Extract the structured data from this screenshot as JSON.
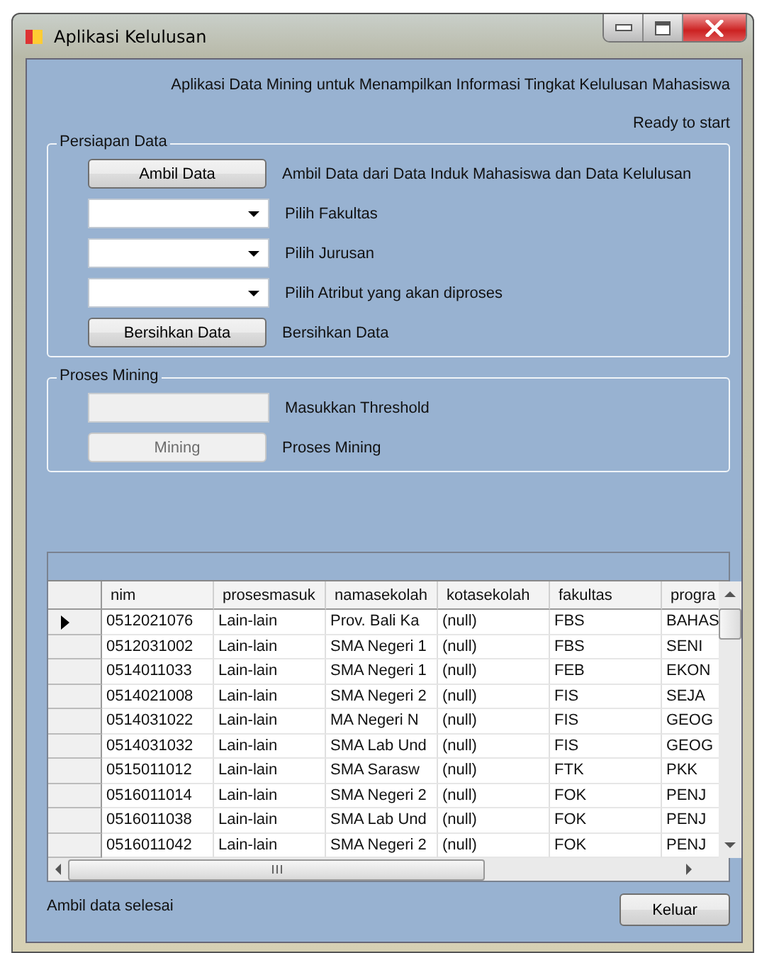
{
  "window": {
    "title": "Aplikasi Kelulusan"
  },
  "heading": "Aplikasi Data Mining untuk Menampilkan Informasi Tingkat Kelulusan Mahasiswa",
  "status_top": "Ready to start",
  "groups": [
    {
      "title": "Persiapan Data",
      "rows": [
        {
          "kind": "button",
          "control": "Ambil Data",
          "label": "Ambil Data dari Data Induk Mahasiswa dan Data Kelulusan",
          "disabled": false
        },
        {
          "kind": "combo",
          "label": "Pilih Fakultas",
          "disabled": false
        },
        {
          "kind": "combo",
          "label": "Pilih Jurusan",
          "disabled": false
        },
        {
          "kind": "combo",
          "label": "Pilih Atribut yang akan diproses",
          "disabled": false
        },
        {
          "kind": "button",
          "control": "Bersihkan Data",
          "label": "Bersihkan Data",
          "disabled": false
        }
      ]
    },
    {
      "title": "Proses Mining",
      "rows": [
        {
          "kind": "input",
          "label": "Masukkan Threshold",
          "disabled": true
        },
        {
          "kind": "button",
          "control": "Mining",
          "label": "Proses Mining",
          "disabled": true
        }
      ]
    }
  ],
  "table": {
    "columns": [
      "nim",
      "prosesmasuk",
      "namasekolah",
      "kotasekolah",
      "fakultas",
      "progra"
    ],
    "rows": [
      {
        "selected": true,
        "cells": [
          "0512021076",
          "Lain-lain",
          "Prov. Bali Ka",
          "(null)",
          "FBS",
          "BAHAS"
        ]
      },
      {
        "selected": false,
        "cells": [
          "0512031002",
          "Lain-lain",
          "SMA Negeri 1",
          "(null)",
          "FBS",
          "SENI"
        ]
      },
      {
        "selected": false,
        "cells": [
          "0514011033",
          "Lain-lain",
          "SMA Negeri 1",
          "(null)",
          "FEB",
          "EKON"
        ]
      },
      {
        "selected": false,
        "cells": [
          "0514021008",
          "Lain-lain",
          "SMA Negeri 2",
          "(null)",
          "FIS",
          "SEJA"
        ]
      },
      {
        "selected": false,
        "cells": [
          "0514031022",
          "Lain-lain",
          "MA Negeri N",
          "(null)",
          "FIS",
          "GEOG"
        ]
      },
      {
        "selected": false,
        "cells": [
          "0514031032",
          "Lain-lain",
          "SMA Lab Und",
          "(null)",
          "FIS",
          "GEOG"
        ]
      },
      {
        "selected": false,
        "cells": [
          "0515011012",
          "Lain-lain",
          "SMA Sarasw",
          "(null)",
          "FTK",
          "PKK"
        ]
      },
      {
        "selected": false,
        "cells": [
          "0516011014",
          "Lain-lain",
          "SMA Negeri 2",
          "(null)",
          "FOK",
          "PENJ"
        ]
      },
      {
        "selected": false,
        "cells": [
          "0516011038",
          "Lain-lain",
          "SMA Lab Und",
          "(null)",
          "FOK",
          "PENJ"
        ]
      },
      {
        "selected": false,
        "cells": [
          "0516011042",
          "Lain-lain",
          "SMA Negeri 2",
          "(null)",
          "FOK",
          "PENJ"
        ]
      }
    ]
  },
  "status_bottom": "Ambil data selesai",
  "exit_button": "Keluar"
}
